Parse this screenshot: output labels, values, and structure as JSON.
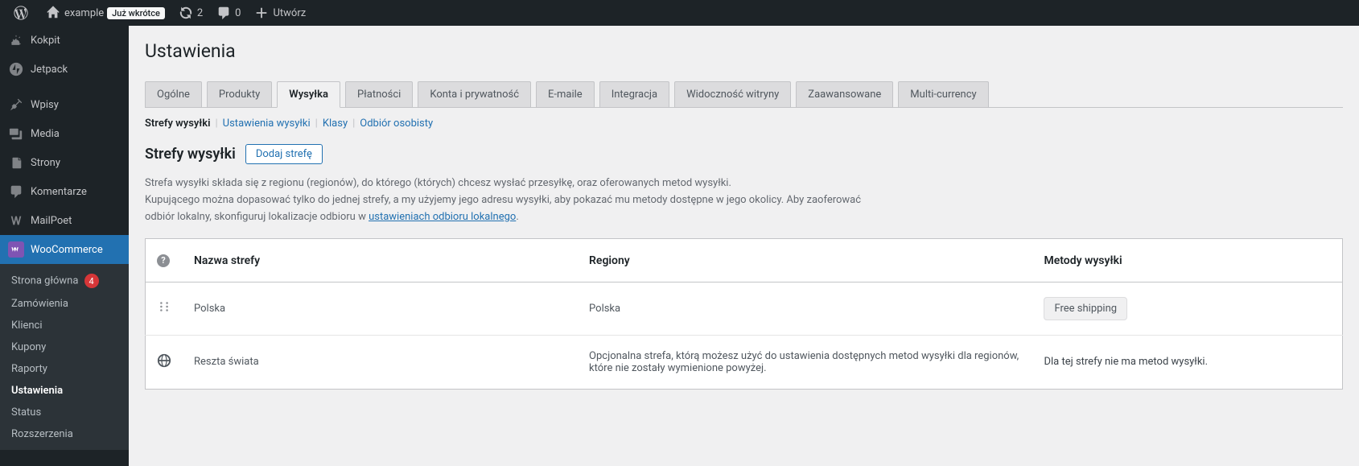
{
  "toolbar": {
    "site_name": "example",
    "status_badge": "Już wkrótce",
    "refresh_count": "2",
    "comments_count": "0",
    "create_label": "Utwórz"
  },
  "sidebar": {
    "items": [
      {
        "label": "Kokpit"
      },
      {
        "label": "Jetpack"
      },
      {
        "label": "Wpisy"
      },
      {
        "label": "Media"
      },
      {
        "label": "Strony"
      },
      {
        "label": "Komentarze"
      },
      {
        "label": "MailPoet"
      },
      {
        "label": "WooCommerce"
      }
    ],
    "submenu": [
      {
        "label": "Strona główna",
        "badge": "4"
      },
      {
        "label": "Zamówienia"
      },
      {
        "label": "Klienci"
      },
      {
        "label": "Kupony"
      },
      {
        "label": "Raporty"
      },
      {
        "label": "Ustawienia"
      },
      {
        "label": "Status"
      },
      {
        "label": "Rozszerzenia"
      }
    ]
  },
  "page_title": "Ustawienia",
  "tabs": [
    {
      "label": "Ogólne"
    },
    {
      "label": "Produkty"
    },
    {
      "label": "Wysyłka"
    },
    {
      "label": "Płatności"
    },
    {
      "label": "Konta i prywatność"
    },
    {
      "label": "E-maile"
    },
    {
      "label": "Integracja"
    },
    {
      "label": "Widoczność witryny"
    },
    {
      "label": "Zaawansowane"
    },
    {
      "label": "Multi-currency"
    }
  ],
  "subnav": [
    {
      "label": "Strefy wysyłki"
    },
    {
      "label": "Ustawienia wysyłki"
    },
    {
      "label": "Klasy"
    },
    {
      "label": "Odbiór osobisty"
    }
  ],
  "zones": {
    "section_title": "Strefy wysyłki",
    "add_button": "Dodaj strefę",
    "description_1": "Strefa wysyłki składa się z regionu (regionów), do którego (których) chcesz wysłać przesyłkę, oraz oferowanych metod wysyłki.",
    "description_2a": "Kupującego można dopasować tylko do jednej strefy, a my użyjemy jego adresu wysyłki, aby pokazać mu metody dostępne w jego okolicy. Aby zaoferować odbiór lokalny, skonfiguruj lokalizacje odbioru w ",
    "description_link": "ustawieniach odbioru lokalnego",
    "description_2b": ".",
    "columns": {
      "name": "Nazwa strefy",
      "regions": "Regiony",
      "methods": "Metody wysyłki"
    },
    "rows": [
      {
        "name": "Polska",
        "regions": "Polska",
        "method": "Free shipping"
      },
      {
        "name": "Reszta świata",
        "regions": "Opcjonalna strefa, którą możesz użyć do ustawienia dostępnych metod wysyłki dla regionów, które nie zostały wymienione powyżej.",
        "no_methods": "Dla tej strefy nie ma metod wysyłki."
      }
    ]
  }
}
